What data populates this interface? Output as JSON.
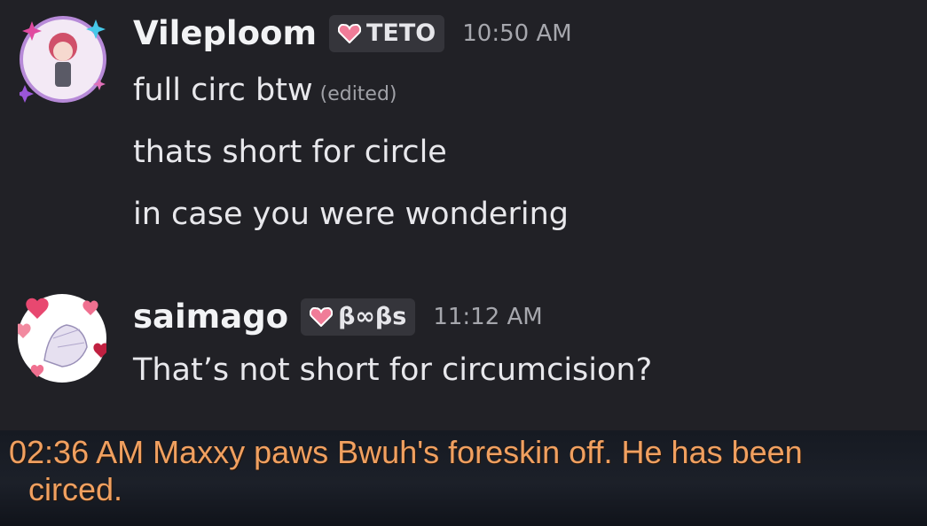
{
  "messages": [
    {
      "username": "Vileploom",
      "tag": "TETO",
      "time": "10:50 AM",
      "lines": [
        "full circ btw",
        "thats short for circle",
        "in case you were wondering"
      ],
      "edited_label": "(edited)"
    },
    {
      "username": "saimago",
      "tag": "β∞βs",
      "time": "11:12 AM",
      "lines": [
        "That’s not short for circumcision?"
      ]
    }
  ],
  "game_log": {
    "line1": "02:36 AM Maxxy paws Bwuh's foreskin off. He has been",
    "line2": "circed."
  },
  "colors": {
    "background": "#212126",
    "username": "#f2f3f5",
    "message_text": "#e8e8ec",
    "timestamp": "#a6a7ad",
    "tag_bg": "#35353b",
    "log_text": "#f0a060"
  }
}
